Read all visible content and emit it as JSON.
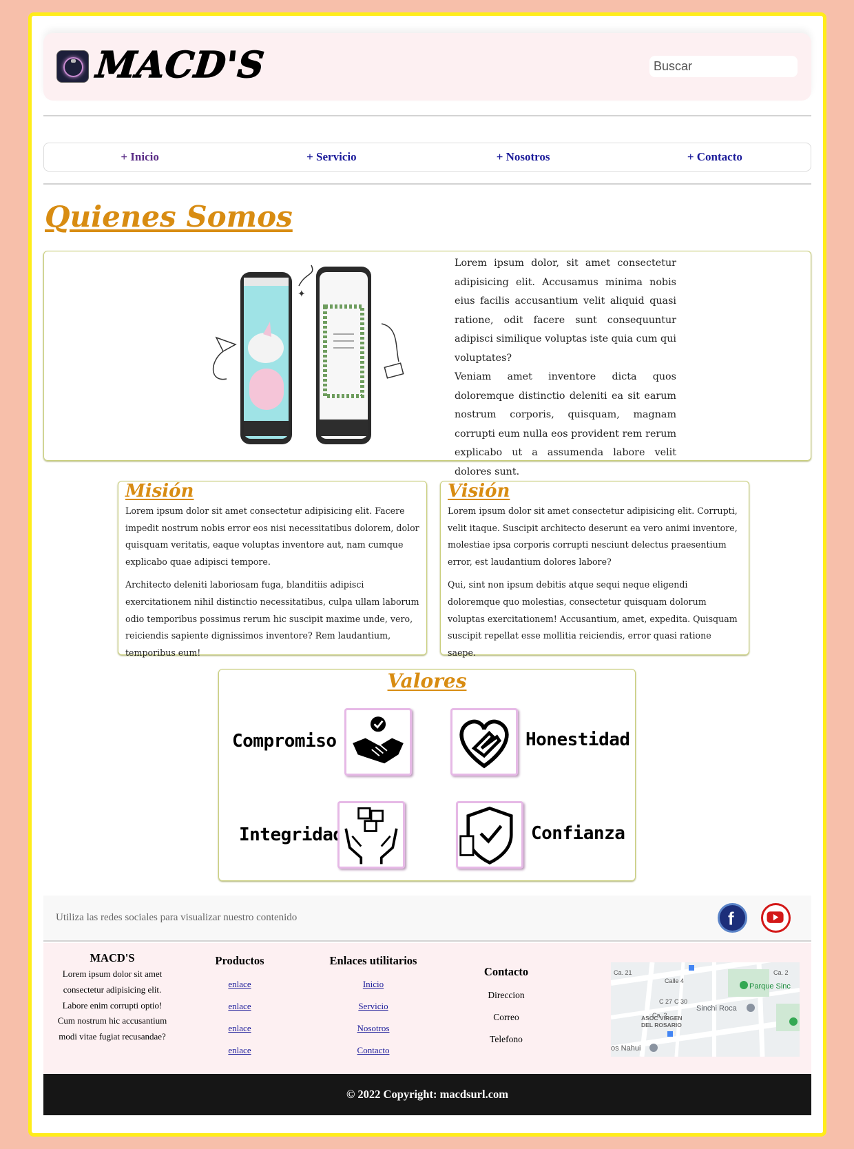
{
  "header": {
    "brand": "MACD'S",
    "search_placeholder": "Buscar"
  },
  "nav": {
    "items": [
      "+ Inicio",
      "+ Servicio",
      "+ Nosotros",
      "+ Contacto"
    ]
  },
  "about": {
    "title": "Quienes Somos",
    "paragraphs": [
      "Lorem ipsum dolor, sit amet consectetur adipisicing elit. Accusamus minima nobis eius facilis accusantium velit aliquid quasi ratione, odit facere sunt consequuntur adipisci similique voluptas iste quia cum qui voluptates?",
      "Veniam amet inventore dicta quos doloremque distinctio deleniti ea sit earum nostrum corporis, quisquam, magnam corrupti eum nulla eos provident rem rerum explicabo ut a assumenda labore velit dolores sunt."
    ]
  },
  "mission": {
    "title": "Misión",
    "paragraphs": [
      "Lorem ipsum dolor sit amet consectetur adipisicing elit. Facere impedit nostrum nobis error eos nisi necessitatibus dolorem, dolor quisquam veritatis, eaque voluptas inventore aut, nam cumque explicabo quae adipisci tempore.",
      "Architecto deleniti laboriosam fuga, blanditiis adipisci exercitationem nihil distinctio necessitatibus, culpa ullam laborum odio temporibus possimus rerum hic suscipit maxime unde, vero, reiciendis sapiente dignissimos inventore? Rem laudantium, temporibus eum!"
    ]
  },
  "vision": {
    "title": "Visión",
    "paragraphs": [
      "Lorem ipsum dolor sit amet consectetur adipisicing elit. Corrupti, velit itaque. Suscipit architecto deserunt ea vero animi inventore, molestiae ipsa corporis corrupti nesciunt delectus praesentium error, est laudantium dolores labore?",
      "Qui, sint non ipsum debitis atque sequi neque eligendi doloremque quo molestias, consectetur quisquam dolorum voluptas exercitationem! Accusantium, amet, expedita. Quisquam suscipit repellat esse mollitia reiciendis, error quasi ratione saepe."
    ]
  },
  "values": {
    "title": "Valores",
    "items": [
      "Compromiso",
      "Honestidad",
      "Integridad",
      "Confianza"
    ]
  },
  "social": {
    "text": "Utiliza las redes sociales para visualizar nuestro contenido"
  },
  "footer": {
    "brand": {
      "title": "MACD'S",
      "text": "Lorem ipsum dolor sit amet consectetur adipisicing elit. Labore enim corrupti optio! Cum nostrum hic accusantium modi vitae fugiat recusandae?"
    },
    "productos": {
      "title": "Productos",
      "links": [
        "enlace",
        "enlace",
        "enlace",
        "enlace"
      ]
    },
    "enlaces": {
      "title": "Enlaces utilitarios",
      "links": [
        "Inicio",
        "Servicio",
        "Nosotros",
        "Contacto"
      ]
    },
    "contacto": {
      "title": "Contacto",
      "items": [
        "Direccion",
        "Correo",
        "Telefono"
      ]
    },
    "map": {
      "labels": [
        "Ca. 21",
        "Calle 4",
        "C 27",
        "C 30",
        "Ca. 2",
        "Parque Sinc",
        "Sinchi Roca",
        "ASOC VIRGEN",
        "DEL ROSARIO",
        "os Nahui",
        "Ca. 2"
      ]
    }
  },
  "copyright": "© 2022 Copyright: macdsurl.com",
  "colors": {
    "page_bg": "#f7bfaa",
    "frame_border": "#ffec1a",
    "accent_title": "#d88c12",
    "nav_link": "#1b1b9a"
  }
}
